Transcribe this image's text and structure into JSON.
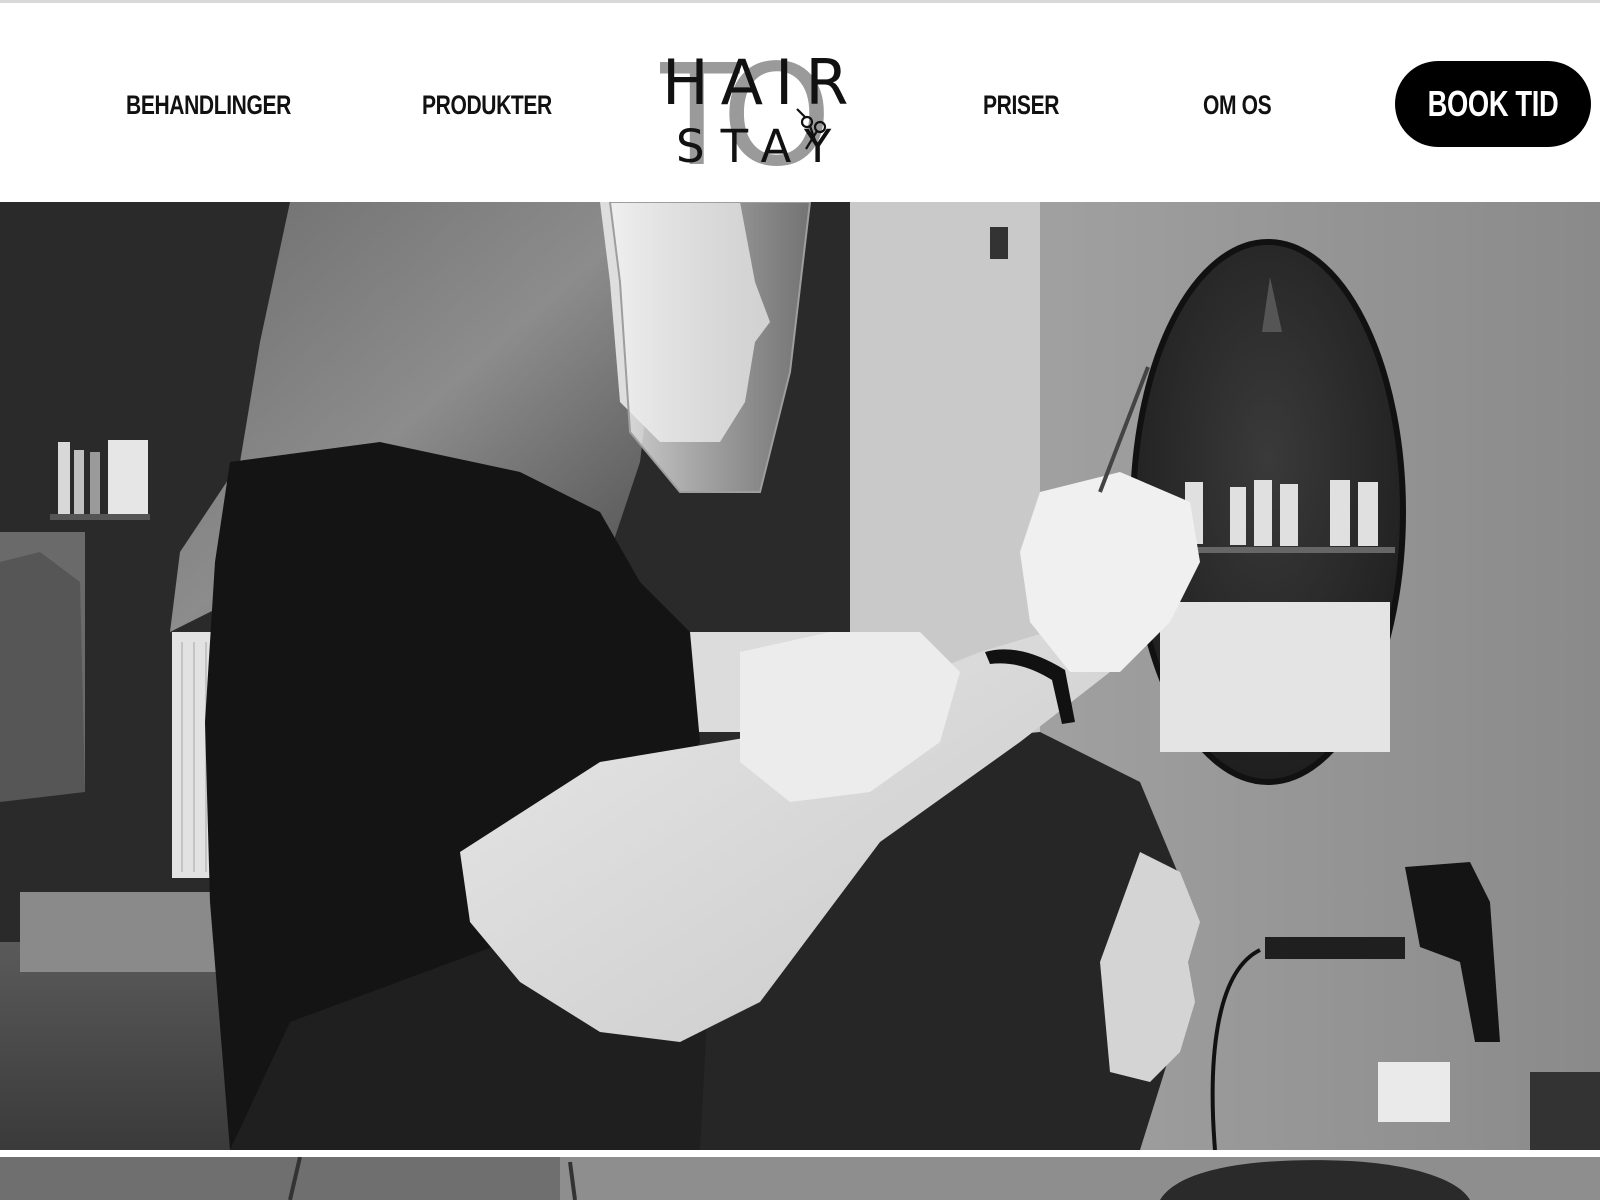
{
  "nav": {
    "items": [
      {
        "label": "BEHANDLINGER"
      },
      {
        "label": "PRODUKTER"
      },
      {
        "label": "PRISER"
      },
      {
        "label": "OM OS"
      }
    ],
    "book_label": "BOOK TID"
  },
  "logo": {
    "word1": "HAIR",
    "word2": "STAY",
    "overlay": "TO",
    "icon": "scissors-icon"
  },
  "hero": {
    "image": "hairdresser-at-work-photo",
    "style": "black-and-white"
  },
  "colors": {
    "text": "#111111",
    "button_bg": "#000000",
    "button_text": "#ffffff",
    "logo_overlay": "#9a9a9a",
    "background": "#ffffff"
  }
}
